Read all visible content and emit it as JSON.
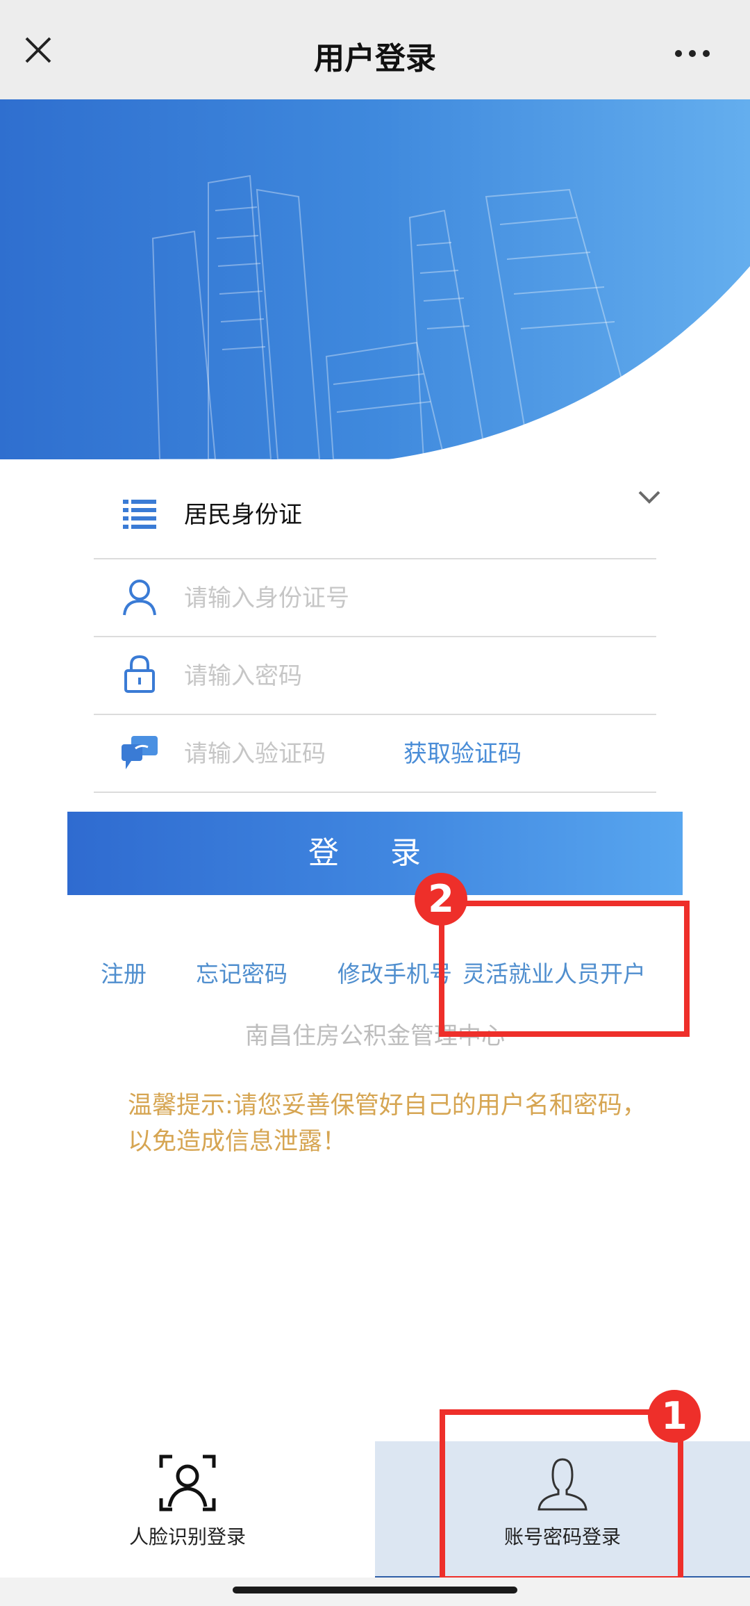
{
  "header": {
    "title": "用户登录",
    "close_icon": "close-icon",
    "more_icon": "more-icon"
  },
  "form": {
    "id_type": "居民身份证",
    "id_number_placeholder": "请输入身份证号",
    "password_placeholder": "请输入密码",
    "code_placeholder": "请输入验证码",
    "get_code": "获取验证码",
    "login": "登 录"
  },
  "links": {
    "register": "注册",
    "forgot_password": "忘记密码",
    "change_phone": "修改手机号",
    "flex_employment": "灵活就业人员开户"
  },
  "org": "南昌住房公积金管理中心",
  "tip": "温馨提示:请您妥善保管好自己的用户名和密码，以免造成信息泄露！",
  "tabs": {
    "face": "人脸识别登录",
    "account": "账号密码登录"
  },
  "annotations": {
    "badge1": "1",
    "badge2": "2"
  },
  "colors": {
    "accent": "#3f85df",
    "link": "#4f8ece",
    "tip": "#d6a552",
    "annotation": "#ee2f2a"
  }
}
